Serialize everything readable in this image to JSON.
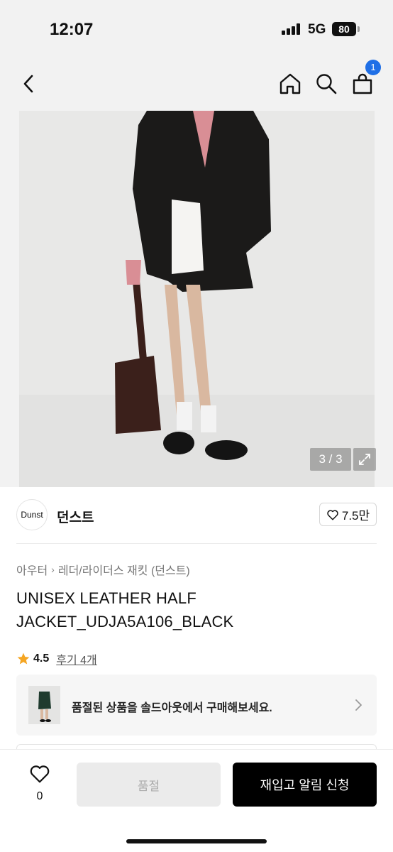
{
  "status_bar": {
    "time": "12:07",
    "network": "5G",
    "battery": "80"
  },
  "header": {
    "cart_count": "1",
    "icons": [
      "back-icon",
      "home-icon",
      "search-icon",
      "cart-icon"
    ]
  },
  "gallery": {
    "counter": "3 / 3"
  },
  "brand": {
    "logo_text": "Dunst",
    "name": "던스트",
    "likes": "7.5만"
  },
  "breadcrumb": {
    "level1": "아우터",
    "level2": "레더/라이더스 재킷 (던스트)"
  },
  "product": {
    "title": "UNISEX LEATHER HALF JACKET_UDJA5A106_BLACK"
  },
  "rating": {
    "value": "4.5",
    "reviews_label": "후기 4개"
  },
  "soldout_banner": {
    "text": "품절된 상품을 솔드아웃에서 구매해보세요."
  },
  "bottom_bar": {
    "wish_count": "0",
    "soldout_label": "품절",
    "restock_label": "재입고 알림 신청"
  },
  "colors": {
    "badge": "#1f6fe6",
    "star": "#f5a623",
    "primary_button": "#000000"
  }
}
